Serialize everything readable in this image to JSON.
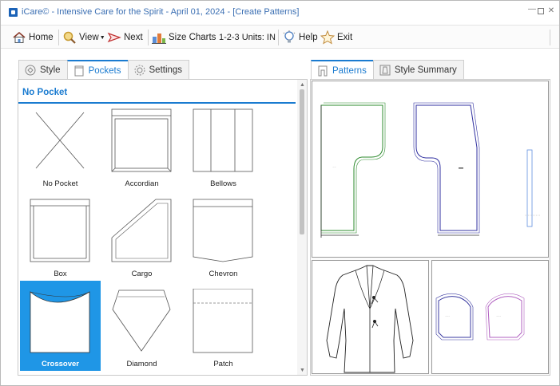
{
  "window": {
    "title": "iCare© - Intensive Care for the Spirit - April 01, 2024 - [Create Patterns]",
    "accent": "#1a7bd0",
    "selected_color": "#1f96e6"
  },
  "toolbar": {
    "home_label": "Home",
    "view_label": "View",
    "next_label": "Next",
    "size_charts_label": "Size Charts",
    "units_label": "1-2-3 Units: IN",
    "help_label": "Help",
    "exit_label": "Exit",
    "icons": [
      "home-icon",
      "magnifier-icon",
      "next-arrow-icon",
      "size-charts-icon",
      "help-bulb-icon",
      "exit-star-icon"
    ]
  },
  "left_tabs": [
    {
      "label": "Style",
      "icon": "style-icon",
      "active": false
    },
    {
      "label": "Pockets",
      "icon": "pocket-icon",
      "active": true
    },
    {
      "label": "Settings",
      "icon": "gear-icon",
      "active": false
    }
  ],
  "pocket_panel": {
    "header": "No Pocket",
    "items": [
      {
        "label": "No Pocket",
        "selected": false
      },
      {
        "label": "Accordian",
        "selected": false
      },
      {
        "label": "Bellows",
        "selected": false
      },
      {
        "label": "Box",
        "selected": false
      },
      {
        "label": "Cargo",
        "selected": false
      },
      {
        "label": "Chevron",
        "selected": false
      },
      {
        "label": "Crossover",
        "selected": true
      },
      {
        "label": "Diamond",
        "selected": false
      },
      {
        "label": "Patch",
        "selected": false
      }
    ]
  },
  "right_tabs": [
    {
      "label": "Patterns",
      "icon": "patterns-icon",
      "active": true
    },
    {
      "label": "Style Summary",
      "icon": "summary-icon",
      "active": false
    }
  ],
  "preview": {
    "pattern_colors": {
      "front": "#2e8b2e",
      "back": "#3030a0",
      "facing": "#6090e0",
      "pocket_left": "#3a3aa0",
      "pocket_right": "#b060c0"
    }
  }
}
